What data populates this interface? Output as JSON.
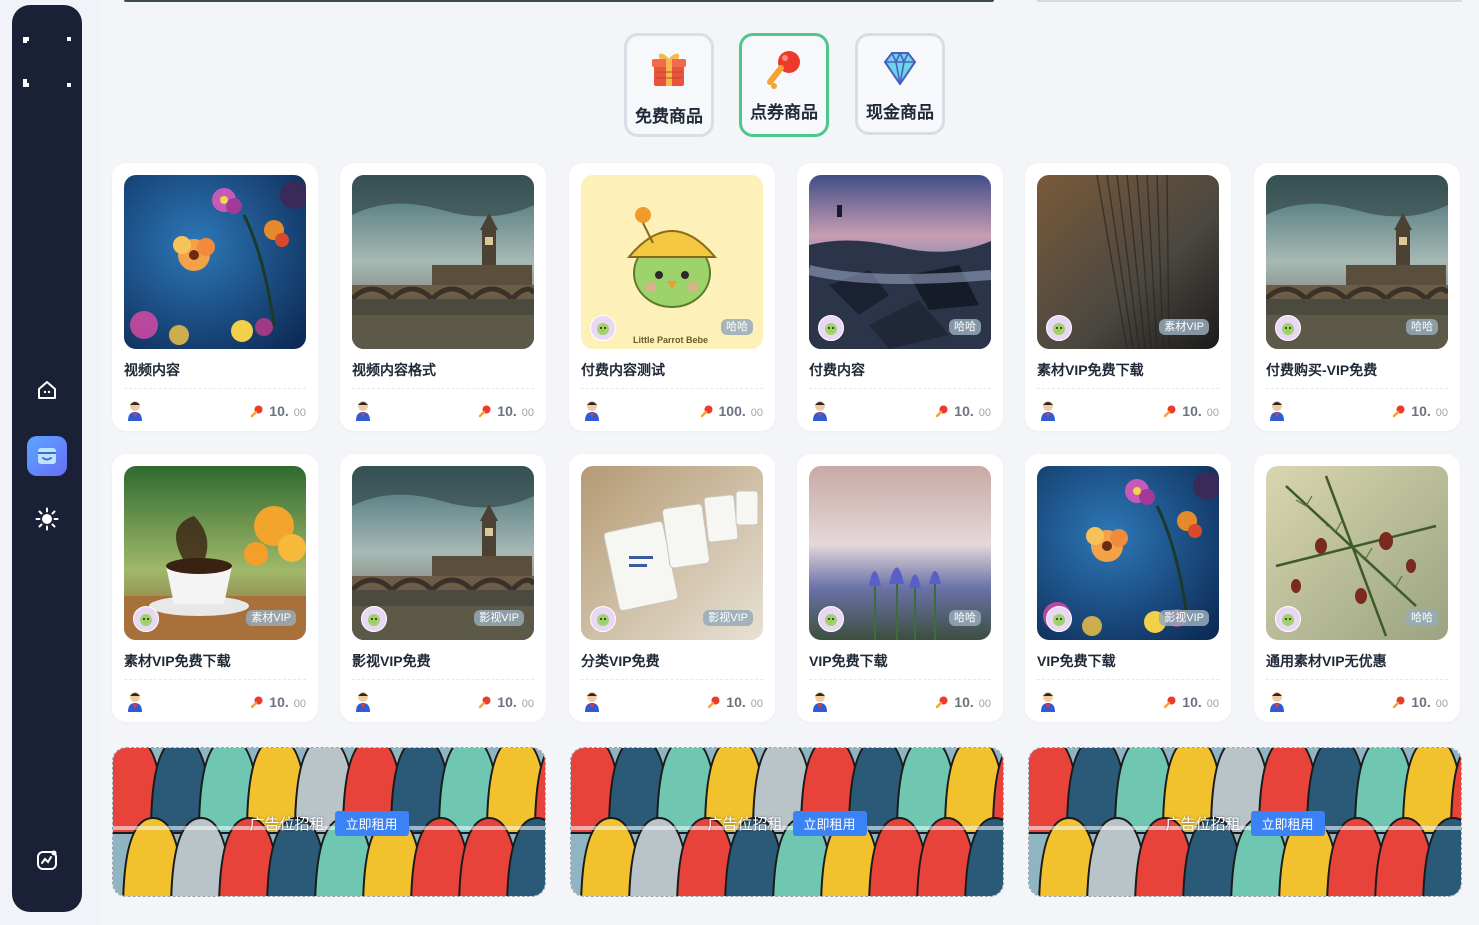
{
  "sidebar": {
    "items": [
      {
        "icon": "home-icon"
      },
      {
        "icon": "store-icon",
        "active": true
      },
      {
        "icon": "sun-icon"
      },
      {
        "icon": "analytics-icon"
      }
    ]
  },
  "tabs": [
    {
      "label": "免费商品",
      "icon": "gift-icon"
    },
    {
      "label": "点券商品",
      "icon": "coupon-icon",
      "active": true
    },
    {
      "label": "现金商品",
      "icon": "diamond-icon"
    }
  ],
  "products": [
    {
      "title": "视频内容",
      "price": "10.",
      "decimal": "00",
      "tag": "",
      "image": "flowers"
    },
    {
      "title": "视频内容格式",
      "price": "10.",
      "decimal": "00",
      "tag": "",
      "image": "bridge"
    },
    {
      "title": "付费内容测试",
      "price": "100.",
      "decimal": "00",
      "tag": "哈哈",
      "image": "parrot"
    },
    {
      "title": "付费内容",
      "price": "10.",
      "decimal": "00",
      "tag": "哈哈",
      "image": "rocks"
    },
    {
      "title": "素材VIP免费下载",
      "price": "10.",
      "decimal": "00",
      "tag": "素材VIP",
      "image": "pages"
    },
    {
      "title": "付费购买-VIP免费",
      "price": "10.",
      "decimal": "00",
      "tag": "哈哈",
      "image": "bridge"
    },
    {
      "title": "素材VIP免费下载",
      "price": "10.",
      "decimal": "00",
      "tag": "素材VIP",
      "image": "coffee"
    },
    {
      "title": "影视VIP免费",
      "price": "10.",
      "decimal": "00",
      "tag": "影视VIP",
      "image": "bridge"
    },
    {
      "title": "分类VIP免费",
      "price": "10.",
      "decimal": "00",
      "tag": "影视VIP",
      "image": "tags"
    },
    {
      "title": "VIP免费下载",
      "price": "10.",
      "decimal": "00",
      "tag": "哈哈",
      "image": "crocus"
    },
    {
      "title": "VIP免费下载",
      "price": "10.",
      "decimal": "00",
      "tag": "影视VIP",
      "image": "flowers"
    },
    {
      "title": "通用素材VIP无优惠",
      "price": "10.",
      "decimal": "00",
      "tag": "哈哈",
      "image": "pine"
    }
  ],
  "parrot_caption": "Little Parrot Bebe",
  "ads": [
    {
      "text": "广告位招租",
      "button": "立即租用"
    },
    {
      "text": "广告位招租",
      "button": "立即租用"
    },
    {
      "text": "广告位招租",
      "button": "立即租用"
    }
  ],
  "colors": {
    "sidebar": "#1a2036",
    "active_tab_border": "#4cc98a",
    "ad_button": "#3b82f6"
  }
}
